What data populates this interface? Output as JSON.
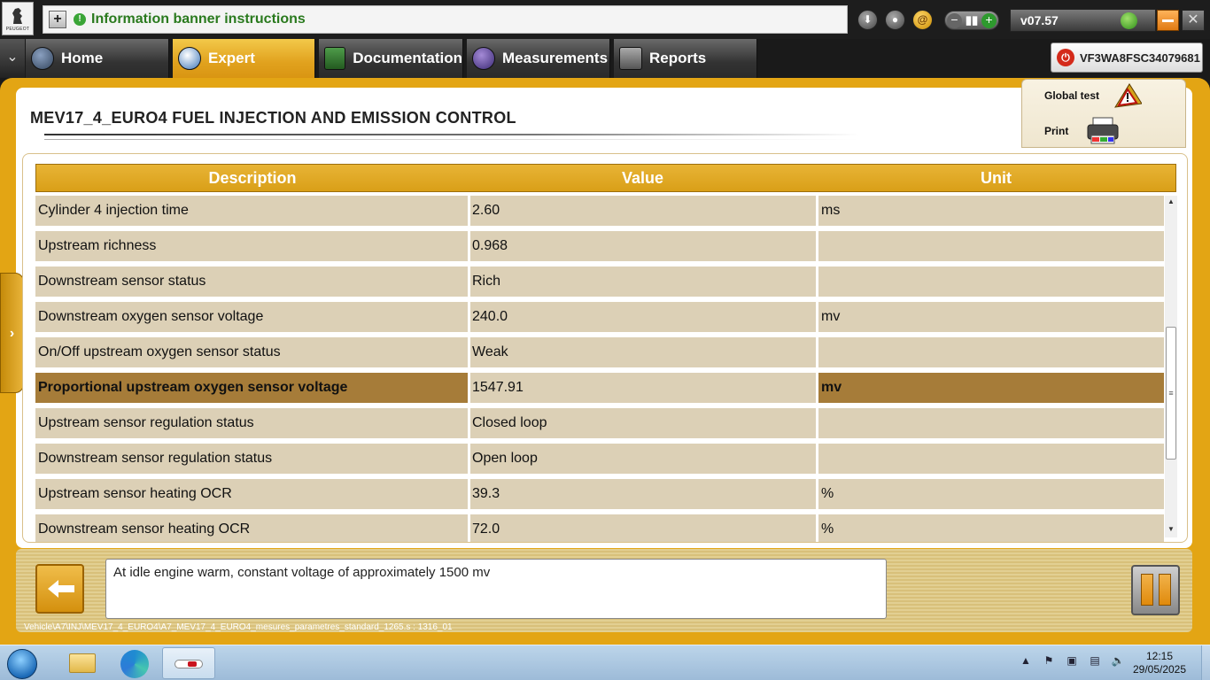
{
  "app": {
    "brand": "PEUGEOT",
    "banner_text": "Information banner instructions",
    "version": "v07.57",
    "vin": "VF3WA8FSC34079681"
  },
  "nav": {
    "tabs": [
      {
        "label": "Home",
        "icon": "home-icon"
      },
      {
        "label": "Expert",
        "icon": "magnifier-icon",
        "active": true
      },
      {
        "label": "Documentation",
        "icon": "book-icon"
      },
      {
        "label": "Measurements",
        "icon": "waveform-icon"
      },
      {
        "label": "Reports",
        "icon": "report-icon"
      }
    ]
  },
  "page": {
    "title": "MEV17_4_EURO4  FUEL INJECTION AND EMISSION CONTROL",
    "actions": {
      "global_test": "Global test",
      "print": "Print"
    }
  },
  "table": {
    "headers": {
      "description": "Description",
      "value": "Value",
      "unit": "Unit"
    },
    "rows": [
      {
        "description": "Cylinder 4 injection time",
        "value": "2.60",
        "unit": "ms"
      },
      {
        "description": "Upstream richness",
        "value": "0.968",
        "unit": ""
      },
      {
        "description": "Downstream sensor status",
        "value": "Rich",
        "unit": ""
      },
      {
        "description": "Downstream oxygen sensor voltage",
        "value": "240.0",
        "unit": "mv"
      },
      {
        "description": "On/Off upstream oxygen sensor status",
        "value": "Weak",
        "unit": ""
      },
      {
        "description": "Proportional upstream oxygen sensor voltage",
        "value": "1547.91",
        "unit": "mv",
        "selected": true
      },
      {
        "description": "Upstream sensor regulation status",
        "value": "Closed loop",
        "unit": ""
      },
      {
        "description": "Downstream sensor regulation status",
        "value": "Open loop",
        "unit": ""
      },
      {
        "description": "Upstream sensor heating OCR",
        "value": "39.3",
        "unit": "%"
      },
      {
        "description": "Downstream sensor heating OCR",
        "value": "72.0",
        "unit": "%"
      }
    ]
  },
  "info": {
    "message": "At idle engine warm, constant voltage of approximately 1500 mv",
    "path": "Vehicle\\A7\\INJ\\MEV17_4_EURO4\\A7_MEV17_4_EURO4_mesures_parametres_standard_1265.s : 1316_01"
  },
  "taskbar": {
    "time": "12:15",
    "date": "29/05/2025"
  },
  "colors": {
    "accent": "#e3a514",
    "selected_row": "#a67c39",
    "row": "#dcd0b6"
  }
}
